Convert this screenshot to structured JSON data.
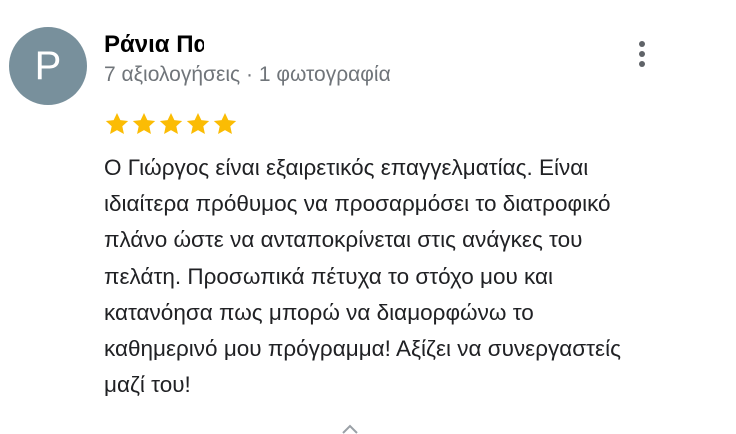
{
  "review": {
    "avatar_letter": "P",
    "avatar_color": "#78909c",
    "reviewer_name": "Ράνια Πα",
    "reviewer_meta": "7 αξιολογήσεις · 1 φωτογραφία",
    "rating": 5,
    "rating_max": 5,
    "star_color": "#fbbc04",
    "text_lines": [
      "Ο Γιώργος είναι εξαιρετικός επαγγελματίας. Είναι",
      "ιδιαίτερα πρόθυμος να προσαρμόσει το διατροφικό",
      "πλάνο ώστε να ανταποκρίνεται στις ανάγκες του",
      "πελάτη. Προσωπικά πέτυχα το στόχο μου και",
      "κατανόησα πως μπορώ να διαμορφώνω το",
      "καθημερινό μου πρόγραμμα! Αξίζει να συνεργαστείς",
      "μαζί του!"
    ]
  },
  "icons": {
    "more_menu": "more-vert-icon",
    "star": "star-icon",
    "expand": "chevron-up-icon"
  }
}
